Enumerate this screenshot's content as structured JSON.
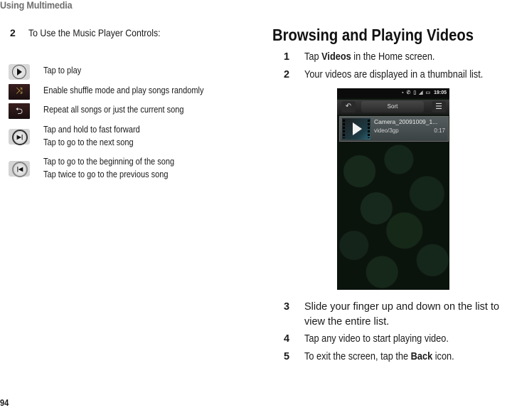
{
  "running_head": "Using Multimedia",
  "page_number": "94",
  "left_column": {
    "step": {
      "number": "2",
      "text": "To Use the Music Player Controls:"
    },
    "controls": [
      {
        "icon": "play-icon",
        "glyph": "▶",
        "lines": [
          "Tap to play"
        ]
      },
      {
        "icon": "shuffle-icon",
        "glyph": "⤨",
        "lines": [
          "Enable shuffle mode and play songs randomly"
        ]
      },
      {
        "icon": "repeat-icon",
        "glyph": "⮌",
        "lines": [
          "Repeat all songs or just the current song"
        ]
      },
      {
        "icon": "next-icon",
        "glyph": "▶|",
        "lines": [
          "Tap and hold to fast forward",
          "Tap to go to the next song"
        ]
      },
      {
        "icon": "previous-icon",
        "glyph": "|◀",
        "lines": [
          "Tap to go to the beginning of the song",
          "Tap twice to go to the previous song"
        ]
      }
    ]
  },
  "right_column": {
    "heading": "Browsing and Playing Videos",
    "steps": [
      {
        "number": "1",
        "pre": "Tap ",
        "bold": "Videos",
        "post": " in the Home screen."
      },
      {
        "number": "2",
        "pre": "Your videos are displayed in a thumbnail list.",
        "bold": "",
        "post": ""
      },
      {
        "number": "3",
        "pre": "Slide your finger up and down on the list to view the entire list.",
        "bold": "",
        "post": ""
      },
      {
        "number": "4",
        "pre": "Tap any video to start playing video.",
        "bold": "",
        "post": ""
      },
      {
        "number": "5",
        "pre": "To exit the screen, tap the ",
        "bold": "Back",
        "post": " icon."
      }
    ],
    "phone_screenshot": {
      "status_time": "19:05",
      "status_icons": "▪ ✆ ▯ ◢ ▭",
      "back_glyph": "↶",
      "sort_label": "Sort",
      "menu_glyph": "☰",
      "video": {
        "title": "Camera_20091009_1...",
        "type": "video/3gp",
        "duration": "0:17"
      }
    }
  }
}
